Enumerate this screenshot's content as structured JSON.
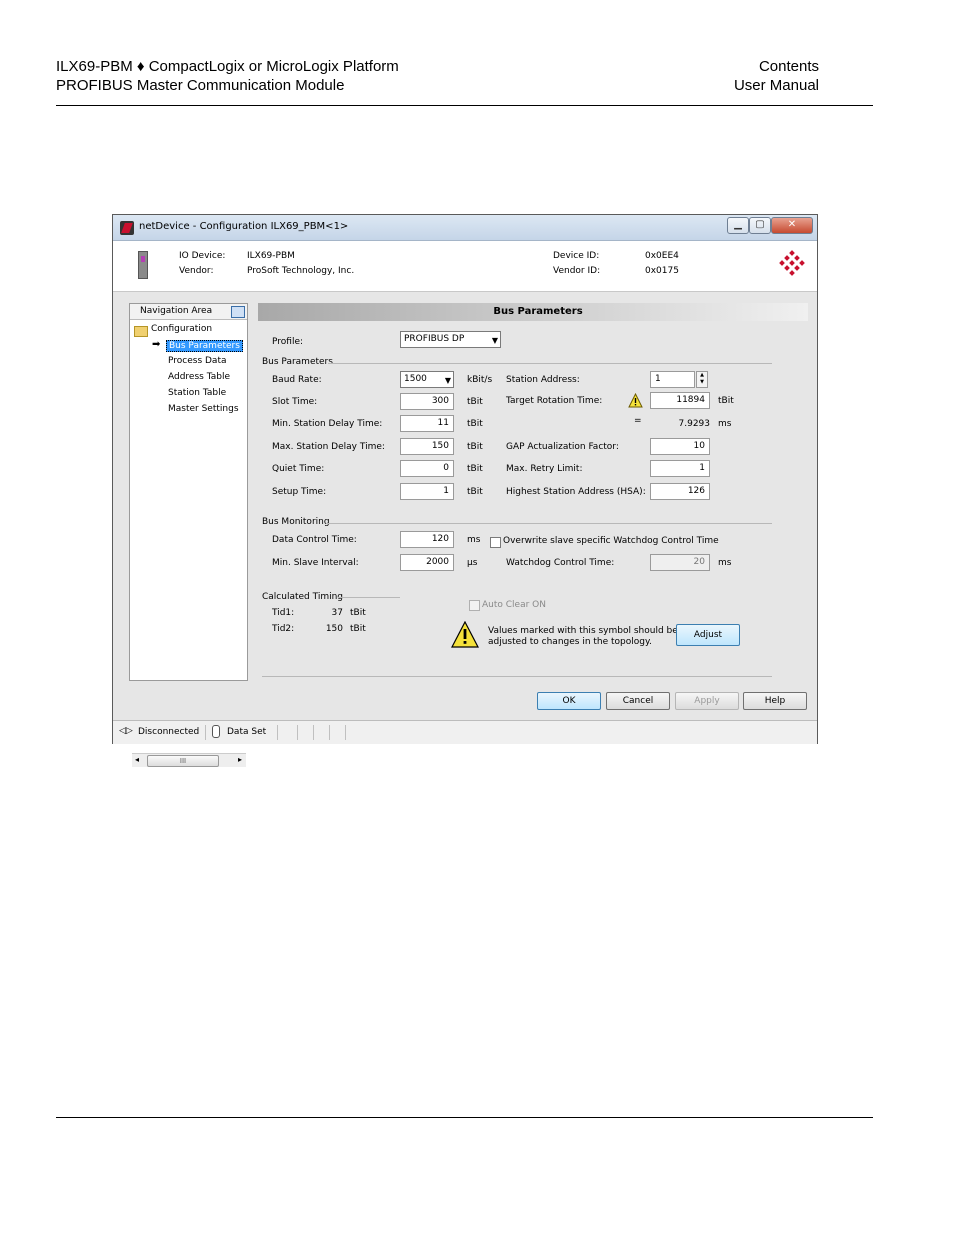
{
  "page_header": {
    "left_line1": "ILX69-PBM ♦ CompactLogix or MicroLogix Platform",
    "left_line2": "PROFIBUS Master Communication Module",
    "right_line1": "Contents",
    "right_line2": "User Manual"
  },
  "window": {
    "title": "netDevice - Configuration ILX69_PBM<1>",
    "min_glyph": "▁",
    "max_glyph": "▢",
    "close_glyph": "✕"
  },
  "device_info": {
    "io_device_label": "IO Device:",
    "io_device_value": "ILX69-PBM",
    "vendor_label": "Vendor:",
    "vendor_value": "ProSoft Technology, Inc.",
    "device_id_label": "Device ID:",
    "device_id_value": "0x0EE4",
    "vendor_id_label": "Vendor ID:",
    "vendor_id_value": "0x0175"
  },
  "navigation": {
    "header": "Navigation Area",
    "root": "Configuration",
    "items": [
      "Bus Parameters",
      "Process Data",
      "Address Table",
      "Station Table",
      "Master Settings"
    ],
    "scroll_thumb": "III",
    "scroll_left": "◂",
    "scroll_right": "▸"
  },
  "panel": {
    "title": "Bus Parameters",
    "profile_label": "Profile:",
    "profile_value": "PROFIBUS DP",
    "bus_parameters_group": "Bus Parameters",
    "baud_rate_label": "Baud Rate:",
    "baud_rate_value": "1500",
    "baud_rate_unit": "kBit/s",
    "slot_time_label": "Slot Time:",
    "slot_time_value": "300",
    "min_station_delay_label": "Min. Station Delay Time:",
    "min_station_delay_value": "11",
    "max_station_delay_label": "Max. Station Delay Time:",
    "max_station_delay_value": "150",
    "quiet_time_label": "Quiet Time:",
    "quiet_time_value": "0",
    "setup_time_label": "Setup Time:",
    "setup_time_value": "1",
    "tbit": "tBit",
    "station_address_label": "Station Address:",
    "station_address_value": "1",
    "target_rotation_label": "Target Rotation Time:",
    "target_rotation_value": "11894",
    "equals": "=",
    "target_rotation_ms_value": "7.9293",
    "ms": "ms",
    "gap_label": "GAP Actualization Factor:",
    "gap_value": "10",
    "max_retry_label": "Max. Retry Limit:",
    "max_retry_value": "1",
    "hsa_label": "Highest Station Address (HSA):",
    "hsa_value": "126",
    "bus_monitoring_group": "Bus Monitoring",
    "data_control_label": "Data Control Time:",
    "data_control_value": "120",
    "min_slave_interval_label": "Min. Slave Interval:",
    "min_slave_interval_value": "2000",
    "us": "μs",
    "overwrite_label": "Overwrite slave specific Watchdog Control Time",
    "watchdog_label": "Watchdog Control Time:",
    "watchdog_value": "20",
    "calculated_timing_group": "Calculated Timing",
    "tid1_label": "Tid1:",
    "tid1_value": "37",
    "tid2_label": "Tid2:",
    "tid2_value": "150",
    "auto_clear_label": "Auto Clear ON",
    "warning_text_line1": "Values marked with this symbol should be",
    "warning_text_line2": "adjusted to changes in the topology.",
    "adjust_button": "Adjust"
  },
  "buttons": {
    "ok": "OK",
    "cancel": "Cancel",
    "apply": "Apply",
    "help": "Help"
  },
  "statusbar": {
    "connection": "Disconnected",
    "dataset": "Data Set"
  },
  "colors": {
    "accent_red": "#c8102e",
    "selection_blue": "#3399ff"
  }
}
